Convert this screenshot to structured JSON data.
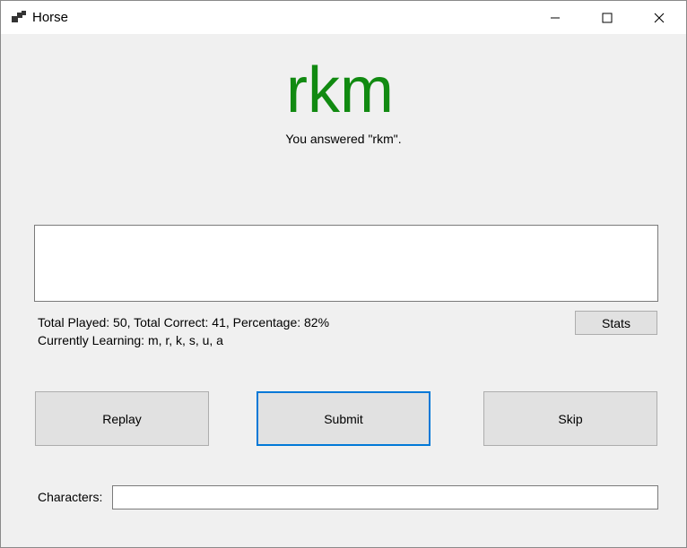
{
  "window": {
    "title": "Horse",
    "icon": "app-window-icon"
  },
  "caption_buttons": {
    "minimize": "minimize-icon",
    "maximize": "maximize-icon",
    "close": "close-icon"
  },
  "main": {
    "answer_display": "rkm",
    "answer_color": "#118a11",
    "answered_message": "You answered \"rkm\".",
    "feedback_text": "",
    "stats_line": "Total Played: 50, Total Correct: 41, Percentage: 82%",
    "learning_line": "Currently Learning: m, r, k, s, u, a"
  },
  "buttons": {
    "stats": "Stats",
    "replay": "Replay",
    "submit": "Submit",
    "skip": "Skip"
  },
  "characters": {
    "label": "Characters:",
    "value": "",
    "placeholder": ""
  },
  "colors": {
    "focus_border": "#0078d7",
    "window_background": "#f0f0f0"
  }
}
